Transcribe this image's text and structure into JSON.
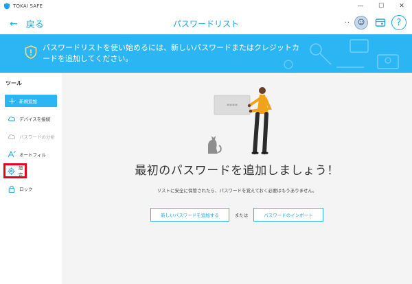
{
  "app": {
    "name": "TOKAI SAFE"
  },
  "window_controls": {
    "minimize": "—",
    "maximize": "☐",
    "close": "✕"
  },
  "header": {
    "back_arrow": "←",
    "back_label": "戻る",
    "title": "パスワードリスト",
    "dots": "··",
    "help_symbol": "?"
  },
  "banner": {
    "text": "パスワードリストを使い始めるには、新しいパスワードまたはクレジットカードを追加してください。"
  },
  "sidebar": {
    "heading": "ツール",
    "items": [
      {
        "label": "新規追加",
        "icon": "plus-icon"
      },
      {
        "label": "デバイスを接続",
        "icon": "cloud-sync-icon"
      },
      {
        "label": "パスワードの分析",
        "icon": "analysis-icon"
      },
      {
        "label": "オートフィル",
        "icon": "autofill-icon"
      },
      {
        "label": "設定",
        "icon": "gear-icon"
      },
      {
        "label": "ロック",
        "icon": "lock-icon"
      }
    ]
  },
  "main": {
    "card_mask": "****",
    "headline": "最初のパスワードを追加しましょう！",
    "subline": "リストに安全に保管されたら、パスワードを覚えておく必要はもうありません。",
    "add_button": "新しいパスワードを追加する",
    "or_label": "または",
    "import_button": "パスワードのインポート"
  },
  "colors": {
    "accent": "#2bb5f2",
    "accent_text": "#1aa3e8",
    "highlight": "#e8001c"
  }
}
